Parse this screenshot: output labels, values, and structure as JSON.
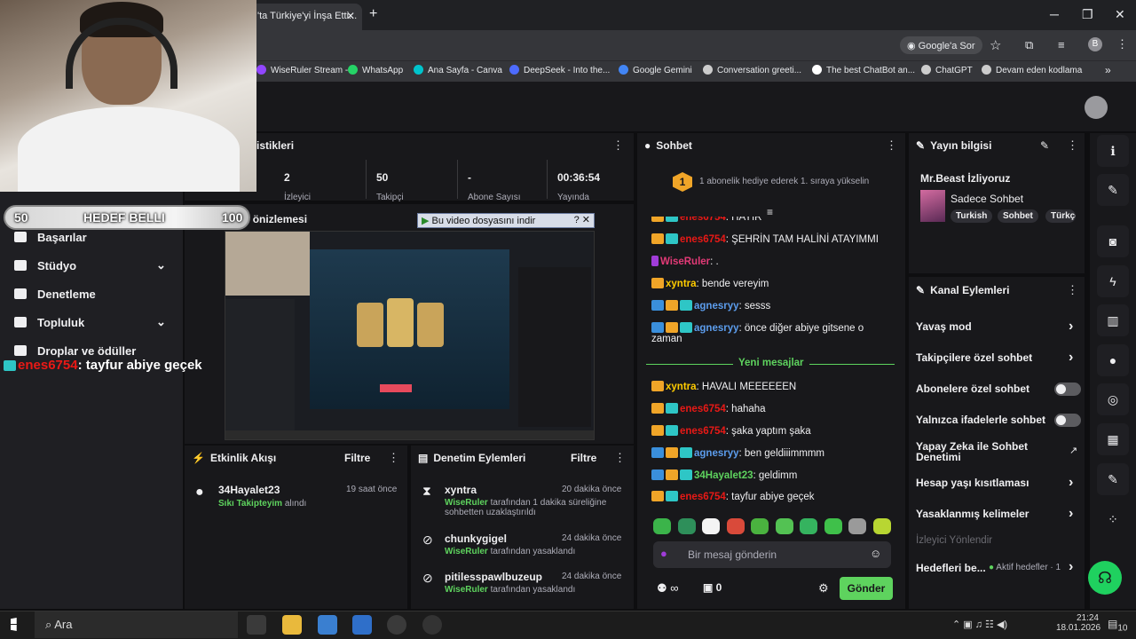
{
  "browser": {
    "tab_title": "'ta Türkiye'yi İnşa Etti...",
    "google_sor": "Google'a Sor",
    "profile_letter": "B",
    "bookmarks": [
      {
        "label": "WiseRuler Stream -...",
        "color": "#9146ff"
      },
      {
        "label": "WhatsApp",
        "color": "#25d366"
      },
      {
        "label": "Ana Sayfa - Canva",
        "color": "#00c4cc"
      },
      {
        "label": "DeepSeek - Into the...",
        "color": "#4d6bfe"
      },
      {
        "label": "Google Gemini",
        "color": "#4285f4"
      },
      {
        "label": "Conversation greeti...",
        "color": "#cccccc"
      },
      {
        "label": "The best ChatBot an...",
        "color": "#ffffff"
      },
      {
        "label": "ChatGPT",
        "color": "#cccccc"
      },
      {
        "label": "Devam eden kodlama",
        "color": "#cccccc"
      }
    ]
  },
  "stats": {
    "header": "istikleri",
    "items": [
      {
        "value": "2",
        "label": "İzleyici"
      },
      {
        "value": "50",
        "label": "Takipçi"
      },
      {
        "value": "-",
        "label": "Abone Sayısı"
      },
      {
        "value": "00:36:54",
        "label": "Yayında"
      }
    ]
  },
  "sidebar": {
    "items": [
      {
        "label": "Başarılar",
        "has_chevron": false
      },
      {
        "label": "Stüdyo",
        "has_chevron": true
      },
      {
        "label": "Denetleme",
        "has_chevron": false
      },
      {
        "label": "Topluluk",
        "has_chevron": true
      },
      {
        "label": "Droplar ve ödüller",
        "has_chevron": false
      }
    ]
  },
  "overlay": {
    "goal_left": "50",
    "goal_text": "HEDEF BELLI",
    "goal_right": "100",
    "preview_title": "Yayın önizlemesi",
    "chat_user": "enes6754",
    "chat_message": ": tayfur abiye geçek",
    "download_bar": "Bu video dosyasını indir"
  },
  "activity": {
    "title": "Etkinlik Akışı",
    "filter": "Filtre",
    "items": [
      {
        "user": "34Hayalet23",
        "time": "19 saat önce",
        "highlight": "Sıkı Takipteyim",
        "rest": "alındı"
      }
    ]
  },
  "moderation": {
    "title": "Denetim Eylemleri",
    "filter": "Filtre",
    "items": [
      {
        "user": "xyntra",
        "time": "20 dakika önce",
        "actor": "WiseRuler",
        "text": "tarafından 1 dakika süreliğine",
        "text2": "sohbetten uzaklaştırıldı"
      },
      {
        "user": "chunkygigel",
        "time": "24 dakika önce",
        "actor": "WiseRuler",
        "text": "tarafından yasaklandı",
        "text2": ""
      },
      {
        "user": "pitilesspawlbuzeup",
        "time": "24 dakika önce",
        "actor": "WiseRuler",
        "text": "tarafından yasaklandı",
        "text2": ""
      }
    ]
  },
  "chat": {
    "title": "Sohbet",
    "gift_rank": "1",
    "gift_text": "1 abonelik hediye ederek 1. sıraya yükselin",
    "new_messages": "Yeni mesajlar",
    "placeholder": "Bir mesaj gönderin",
    "points": "0",
    "send": "Gönder",
    "messages": [
      {
        "user": "enes6754",
        "cls": "u-red",
        "badges": [
          "b-crown",
          "b-sub"
        ],
        "text": ": HAYIR"
      },
      {
        "user": "enes6754",
        "cls": "u-red",
        "badges": [
          "b-crown",
          "b-sub"
        ],
        "text": ": ŞEHRİN TAM HALİNİ ATAYIMMI"
      },
      {
        "user": "WiseRuler",
        "cls": "u-pink",
        "badges": [
          "b-mic"
        ],
        "text": ": ."
      },
      {
        "user": "xyntra",
        "cls": "u-yellow",
        "badges": [
          "b-crown"
        ],
        "text": ": bende vereyim"
      },
      {
        "user": "agnesryy",
        "cls": "u-blue",
        "badges": [
          "b-blue",
          "b-crown",
          "b-sub"
        ],
        "text": ": sesss"
      },
      {
        "user": "agnesryy",
        "cls": "u-blue",
        "badges": [
          "b-blue",
          "b-crown",
          "b-sub"
        ],
        "text": ": önce diğer abiye gitsene o",
        "cont": "zaman"
      },
      {
        "user": "xyntra",
        "cls": "u-yellow",
        "badges": [
          "b-crown"
        ],
        "text": ": HAVALI MEEEEEEN"
      },
      {
        "user": "enes6754",
        "cls": "u-red",
        "badges": [
          "b-crown",
          "b-sub"
        ],
        "text": ": hahaha"
      },
      {
        "user": "enes6754",
        "cls": "u-red",
        "badges": [
          "b-crown",
          "b-sub"
        ],
        "text": ": şaka yaptım şaka"
      },
      {
        "user": "agnesryy",
        "cls": "u-blue",
        "badges": [
          "b-blue",
          "b-crown",
          "b-sub"
        ],
        "text": ": ben geldiiimmmm"
      },
      {
        "user": "34Hayalet23",
        "cls": "u-green",
        "badges": [
          "b-blue",
          "b-crown",
          "b-sub"
        ],
        "text": ": geldimm"
      },
      {
        "user": "enes6754",
        "cls": "u-red",
        "badges": [
          "b-crown",
          "b-sub"
        ],
        "text": ": tayfur abiye geçek"
      }
    ]
  },
  "stream_info": {
    "title": "Yayın bilgisi",
    "stream_title": "Mr.Beast İzliyoruz",
    "category": "Sadece Sohbet",
    "tags": [
      "Turkish",
      "Sohbet",
      "Türkçe"
    ]
  },
  "channel_actions": {
    "title": "Kanal Eylemleri",
    "items": [
      {
        "label": "Yavaş mod",
        "type": "arrow"
      },
      {
        "label": "Takipçilere özel sohbet",
        "type": "arrow"
      },
      {
        "label": "Abonelere özel sohbet",
        "type": "toggle"
      },
      {
        "label": "Yalnızca ifadelerle sohbet",
        "type": "toggle"
      },
      {
        "label": "Yapay Zeka ile Sohbet",
        "label2": "Denetimi",
        "type": "external"
      },
      {
        "label": "Hesap yaşı kısıtlaması",
        "type": "arrow"
      },
      {
        "label": "Yasaklanmış kelimeler",
        "type": "arrow"
      }
    ],
    "viewer_guide": "İzleyici Yönlendir",
    "goals": "Hedefleri be...",
    "active_goals": "Aktif hedefler · 1"
  },
  "taskbar": {
    "search": "Ara",
    "time": "21:24",
    "date": "18.01.2026",
    "notif": "10"
  }
}
